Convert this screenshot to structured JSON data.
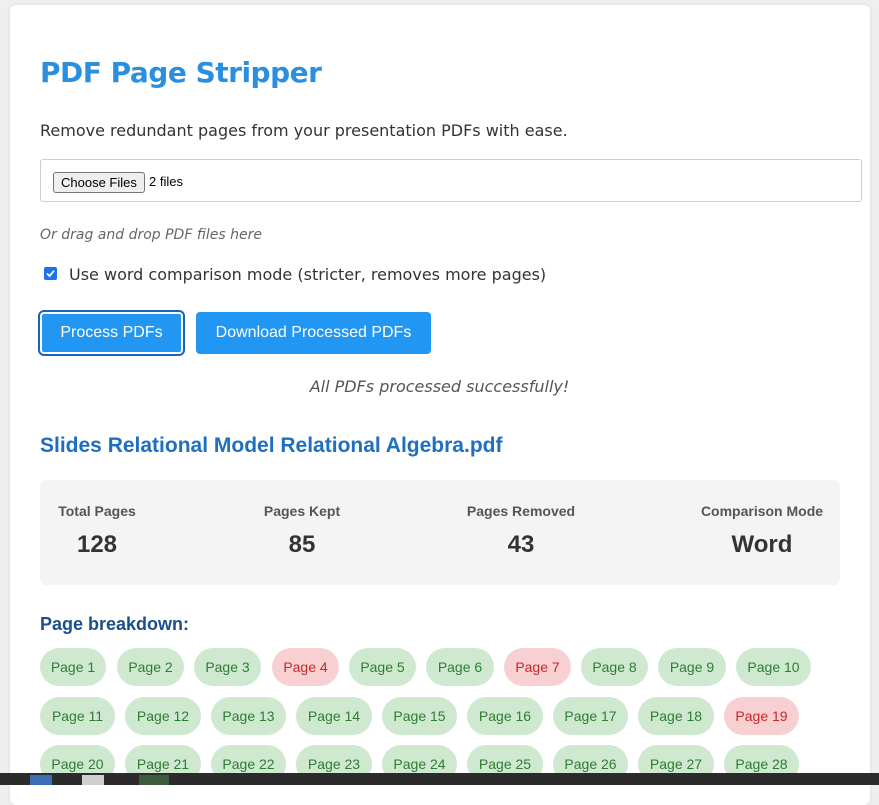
{
  "app": {
    "title": "PDF Page Stripper",
    "subtitle": "Remove redundant pages from your presentation PDFs with ease."
  },
  "file_input": {
    "button_label": "Choose Files",
    "selected_text": "2 files"
  },
  "drop_hint": "Or drag and drop PDF files here",
  "options": {
    "word_mode_label": "Use word comparison mode (stricter, removes more pages)",
    "word_mode_checked": true
  },
  "actions": {
    "process_label": "Process PDFs",
    "download_label": "Download Processed PDFs"
  },
  "status_message": "All PDFs processed successfully!",
  "result": {
    "filename": "Slides Relational Model Relational Algebra.pdf",
    "stats": [
      {
        "label": "Total Pages",
        "value": "128"
      },
      {
        "label": "Pages Kept",
        "value": "85"
      },
      {
        "label": "Pages Removed",
        "value": "43"
      },
      {
        "label": "Comparison Mode",
        "value": "Word"
      }
    ],
    "breakdown_title": "Page breakdown:",
    "pages": [
      {
        "label": "Page 1",
        "status": "kept"
      },
      {
        "label": "Page 2",
        "status": "kept"
      },
      {
        "label": "Page 3",
        "status": "kept"
      },
      {
        "label": "Page 4",
        "status": "removed"
      },
      {
        "label": "Page 5",
        "status": "kept"
      },
      {
        "label": "Page 6",
        "status": "kept"
      },
      {
        "label": "Page 7",
        "status": "removed"
      },
      {
        "label": "Page 8",
        "status": "kept"
      },
      {
        "label": "Page 9",
        "status": "kept"
      },
      {
        "label": "Page 10",
        "status": "kept"
      },
      {
        "label": "Page 11",
        "status": "kept"
      },
      {
        "label": "Page 12",
        "status": "kept"
      },
      {
        "label": "Page 13",
        "status": "kept"
      },
      {
        "label": "Page 14",
        "status": "kept"
      },
      {
        "label": "Page 15",
        "status": "kept"
      },
      {
        "label": "Page 16",
        "status": "kept"
      },
      {
        "label": "Page 17",
        "status": "kept"
      },
      {
        "label": "Page 18",
        "status": "kept"
      },
      {
        "label": "Page 19",
        "status": "removed"
      },
      {
        "label": "Page 20",
        "status": "kept"
      },
      {
        "label": "Page 21",
        "status": "kept"
      },
      {
        "label": "Page 22",
        "status": "kept"
      },
      {
        "label": "Page 23",
        "status": "kept"
      },
      {
        "label": "Page 24",
        "status": "kept"
      },
      {
        "label": "Page 25",
        "status": "kept"
      },
      {
        "label": "Page 26",
        "status": "kept"
      },
      {
        "label": "Page 27",
        "status": "kept"
      },
      {
        "label": "Page 28",
        "status": "kept"
      }
    ]
  },
  "colors": {
    "accent": "#2196f3",
    "title": "#2b8fe0",
    "kept_bg": "#cfe8d0",
    "kept_text": "#2e7d32",
    "removed_bg": "#f8d0d2",
    "removed_text": "#c62828"
  }
}
